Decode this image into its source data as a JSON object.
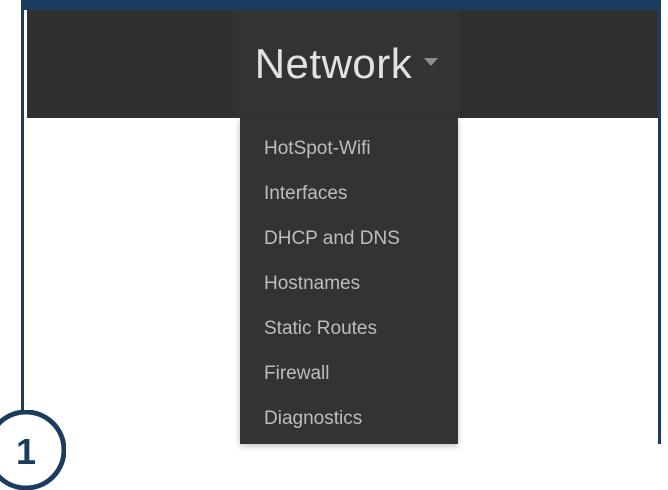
{
  "navbar": {
    "active_menu": {
      "label": "Network",
      "icon": "caret-down-icon"
    }
  },
  "dropdown": {
    "items": [
      {
        "label": "HotSpot-Wifi"
      },
      {
        "label": "Interfaces"
      },
      {
        "label": "DHCP and DNS"
      },
      {
        "label": "Hostnames"
      },
      {
        "label": "Static Routes"
      },
      {
        "label": "Firewall"
      },
      {
        "label": "Diagnostics"
      }
    ]
  },
  "annotation": {
    "step_number": "1"
  },
  "colors": {
    "frame_border": "#1b3c5e",
    "navbar_bg": "#2f2f2f",
    "menu_bg": "#333333",
    "nav_text": "#e2e2e2",
    "menu_text": "#bdbdbd",
    "caret": "#8f8f8f"
  }
}
